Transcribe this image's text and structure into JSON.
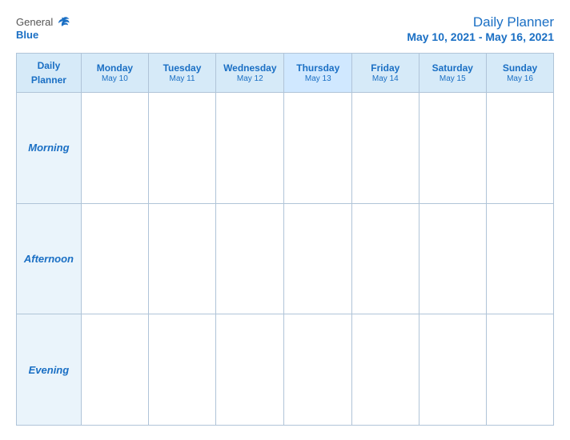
{
  "logo": {
    "general": "General",
    "blue": "Blue"
  },
  "title": {
    "main": "Daily Planner",
    "sub": "May 10, 2021 - May 16, 2021"
  },
  "table": {
    "label_header": "Daily Planner",
    "days": [
      {
        "name": "Monday",
        "date": "May 10"
      },
      {
        "name": "Tuesday",
        "date": "May 11"
      },
      {
        "name": "Wednesday",
        "date": "May 12"
      },
      {
        "name": "Thursday",
        "date": "May 13",
        "highlighted": true
      },
      {
        "name": "Friday",
        "date": "May 14"
      },
      {
        "name": "Saturday",
        "date": "May 15"
      },
      {
        "name": "Sunday",
        "date": "May 16"
      }
    ],
    "rows": [
      {
        "label": "Morning"
      },
      {
        "label": "Afternoon"
      },
      {
        "label": "Evening"
      }
    ]
  }
}
